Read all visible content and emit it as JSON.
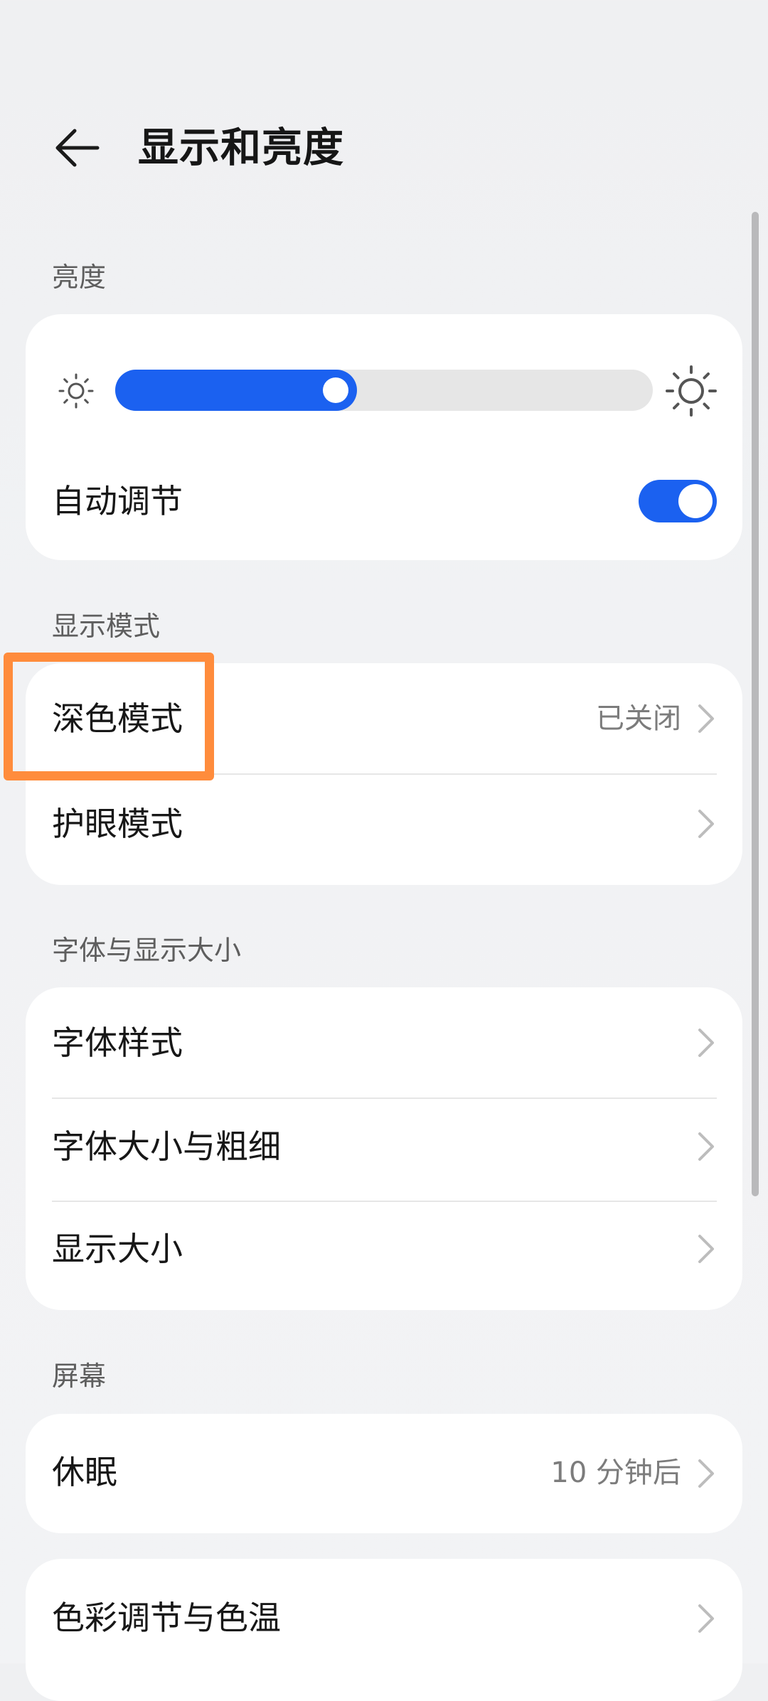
{
  "header": {
    "title": "显示和亮度",
    "back_icon": "arrow-left-icon"
  },
  "brightness": {
    "section_label": "亮度",
    "level": 0.45,
    "min_icon": "sun-dim-icon",
    "max_icon": "sun-bright-icon",
    "auto_label": "自动调节",
    "auto_enabled": true
  },
  "display_mode": {
    "section_label": "显示模式",
    "dark_mode_label": "深色模式",
    "dark_mode_value": "已关闭",
    "eye_comfort_label": "护眼模式"
  },
  "font_display": {
    "section_label": "字体与显示大小",
    "font_style_label": "字体样式",
    "font_size_label": "字体大小与粗细",
    "display_size_label": "显示大小"
  },
  "screen": {
    "section_label": "屏幕",
    "sleep_label": "休眠",
    "sleep_value": "10 分钟后",
    "color_label": "色彩调节与色温"
  },
  "colors": {
    "accent": "#1b61f0",
    "highlight": "#ff8c3c",
    "background": "#f1f2f4",
    "card": "#ffffff"
  }
}
